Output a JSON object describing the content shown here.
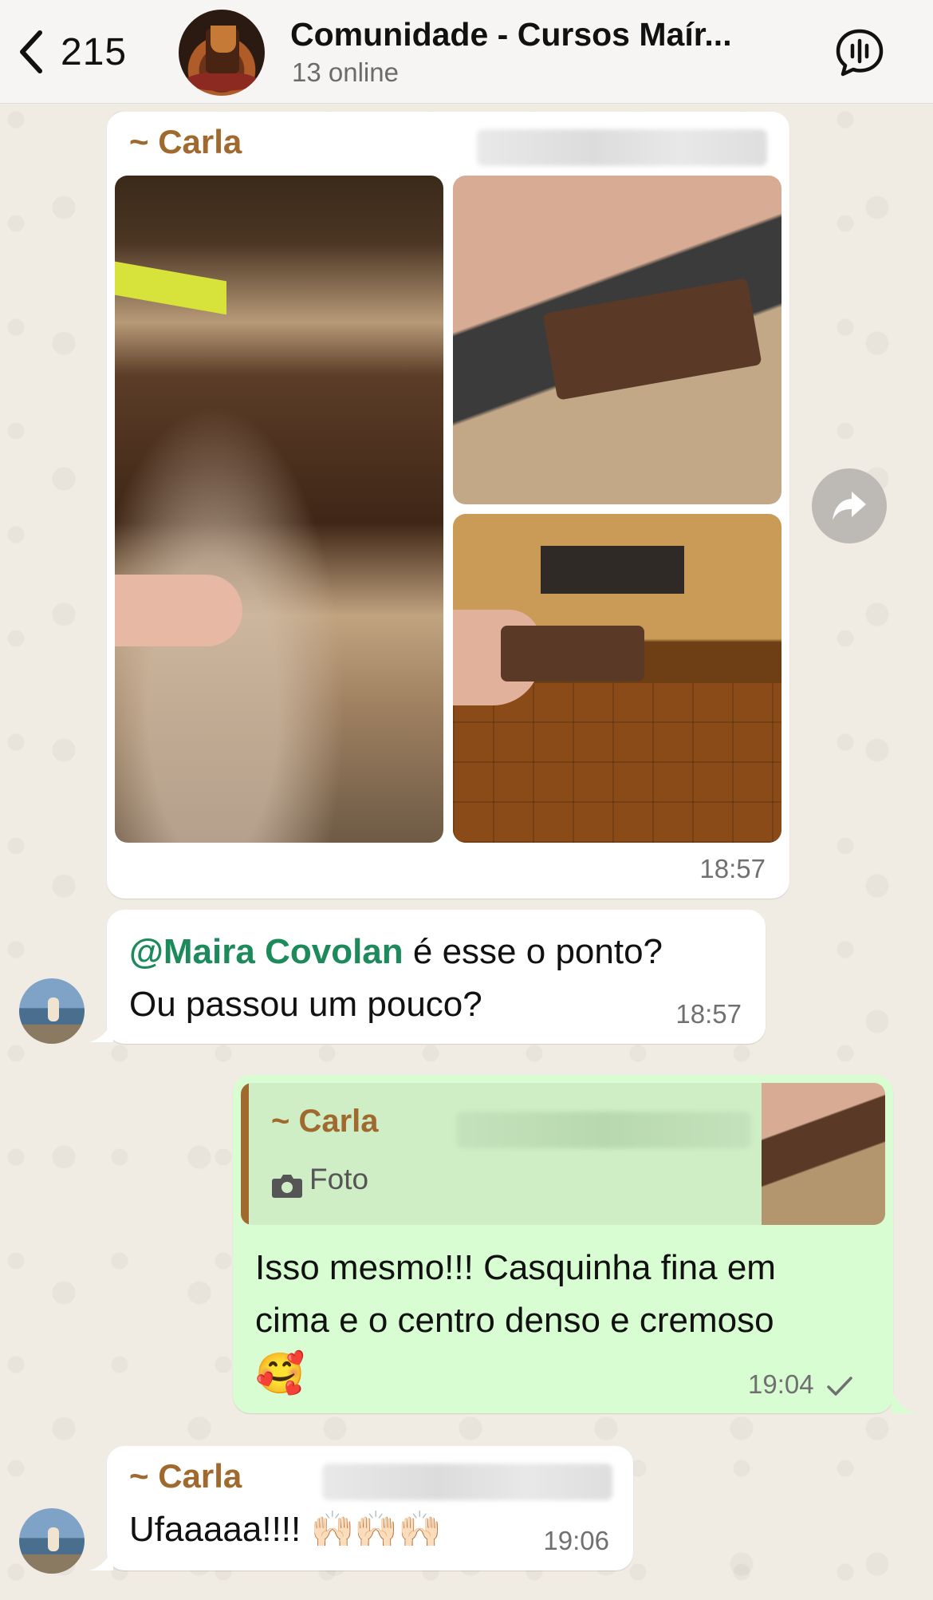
{
  "header": {
    "back_count": "215",
    "title": "Comunidade - Cursos Maír...",
    "subtitle": "13 online"
  },
  "messages": [
    {
      "sender": "~ Carla",
      "type": "photos",
      "photo_count": 3,
      "time": "18:57"
    },
    {
      "mention": "@Maira Covolan",
      "text_line1": " é esse o ponto?",
      "text_line2": "Ou passou um pouco?",
      "time": "18:57"
    },
    {
      "type": "outgoing-reply",
      "reply_sender": "~ Carla",
      "reply_label": "Foto",
      "text_line1": "Isso mesmo!!! Casquinha fina em",
      "text_line2": "cima e o centro denso e cremoso",
      "emoji": "🥰",
      "time": "19:04"
    },
    {
      "sender": "~ Carla",
      "text": "Ufaaaaa!!!! 🙌🏻🙌🏻🙌🏻",
      "time": "19:06"
    }
  ],
  "colors": {
    "sender": "#a0692e",
    "mention": "#1d8a5c",
    "outgoing_bubble": "#d9fdd3"
  }
}
